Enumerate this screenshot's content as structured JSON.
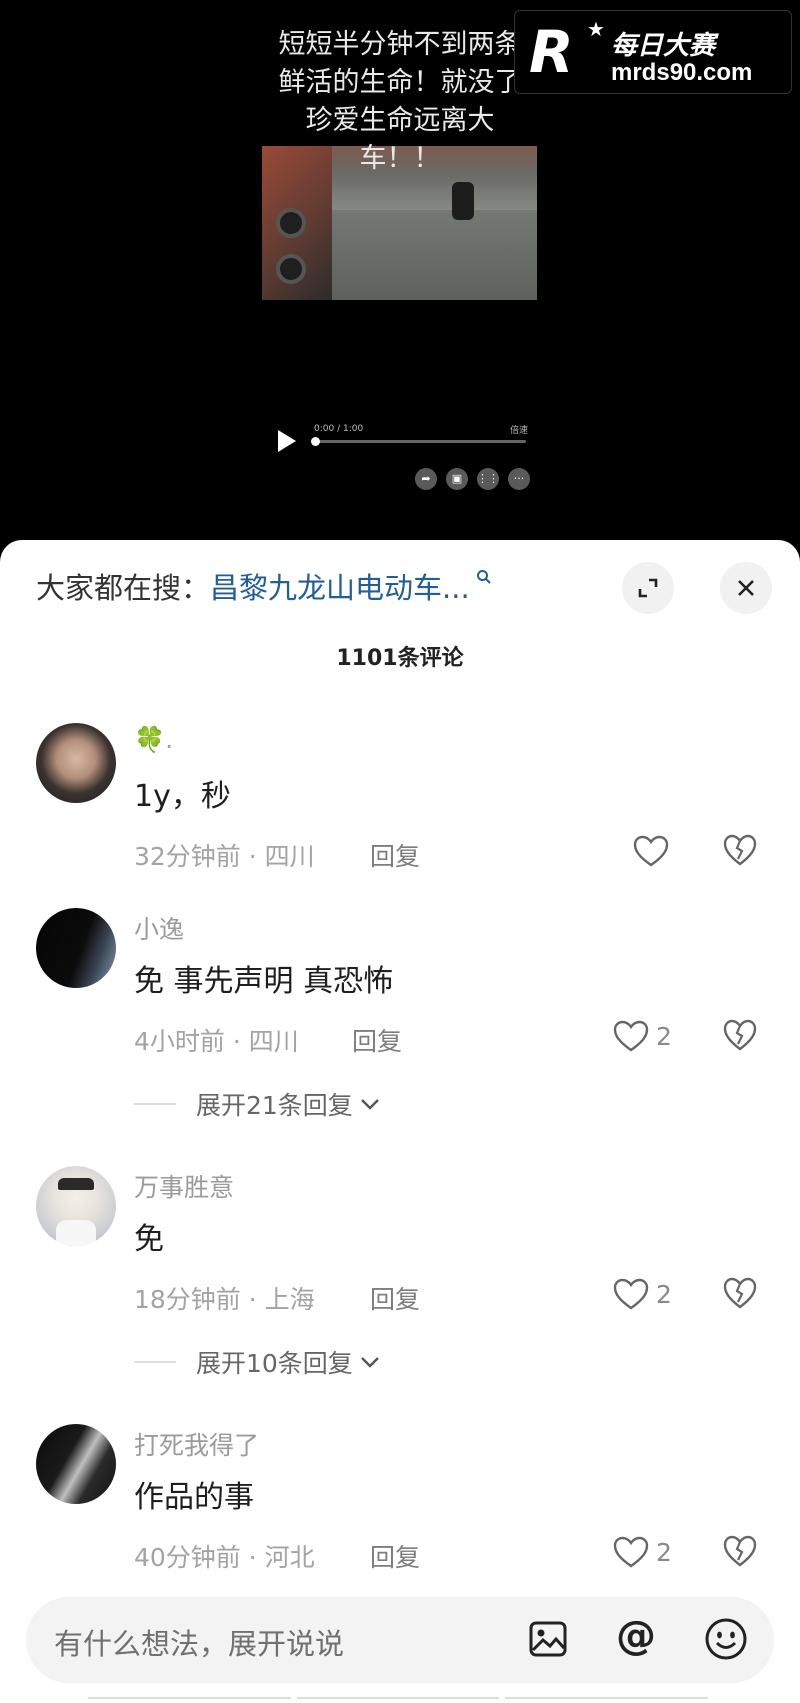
{
  "video": {
    "caption": "短短半分钟不到两条鲜活的生命！就没了珍爱生命远离大车！！",
    "time": "0:00 / 1:00",
    "speed_label": "倍速"
  },
  "watermark": {
    "brand": "每日大赛",
    "site": "mrds90.com"
  },
  "sheet": {
    "search_prefix": "大家都在搜：",
    "search_term": "昌黎九龙山电动车...",
    "comment_count": "1101条评论"
  },
  "comments": [
    {
      "user": "🍀.",
      "text": "1y，秒",
      "time": "32分钟前 · 四川",
      "reply": "回复",
      "likes": ""
    },
    {
      "user": "小逸",
      "text": "免 事先声明 真恐怖",
      "time": "4小时前 · 四川",
      "reply": "回复",
      "likes": "2",
      "expand": "展开21条回复"
    },
    {
      "user": "万事胜意",
      "text": "免",
      "time": "18分钟前 · 上海",
      "reply": "回复",
      "likes": "2",
      "expand": "展开10条回复"
    },
    {
      "user": "打死我得了",
      "text": "作品的事",
      "time": "40分钟前 · 河北",
      "reply": "回复",
      "likes": "2"
    }
  ],
  "input": {
    "placeholder": "有什么想法，展开说说",
    "at_symbol": "@"
  },
  "colors": {
    "accent_link": "#235e94",
    "sheet_bg": "#ffffff",
    "video_bg": "#000000"
  }
}
